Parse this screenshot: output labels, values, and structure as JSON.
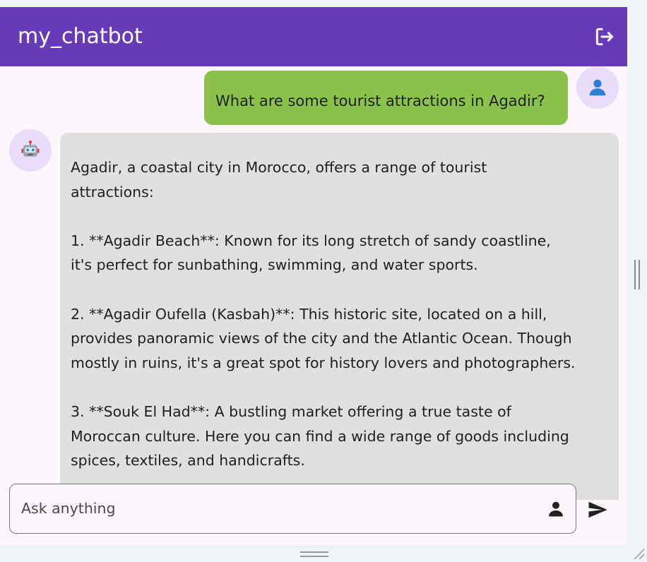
{
  "app": {
    "title": "my_chatbot",
    "icons": {
      "logout": "logout-icon",
      "user_avatar": "person-icon",
      "bot_avatar": "robot-icon",
      "input_person": "person-icon",
      "send": "send-icon"
    },
    "colors": {
      "appbar": "#673ab7",
      "user_bubble": "#8bc34a",
      "bot_bubble": "#e0e0e0",
      "avatar_bg": "#e9ddfb",
      "background": "#fdf7fd"
    }
  },
  "messages": {
    "user_text": "What are some tourist attractions in Agadir?",
    "bot_lines": [
      "Agadir, a coastal city in Morocco, offers a range of tourist",
      "attractions:",
      "",
      "1. **Agadir Beach**: Known for its long stretch of sandy coastline,",
      "it's perfect for sunbathing, swimming, and water sports.",
      "",
      "2. **Agadir Oufella (Kasbah)**: This historic site, located on a hill,",
      "provides panoramic views of the city and the Atlantic Ocean. Though",
      "mostly in ruins, it's a great spot for history lovers and photographers.",
      "",
      "3. **Souk El Had**: A bustling market offering a true taste of",
      "Moroccan culture. Here you can find a wide range of goods including",
      "spices, textiles, and handicrafts."
    ]
  },
  "composer": {
    "placeholder": "Ask anything",
    "value": ""
  }
}
